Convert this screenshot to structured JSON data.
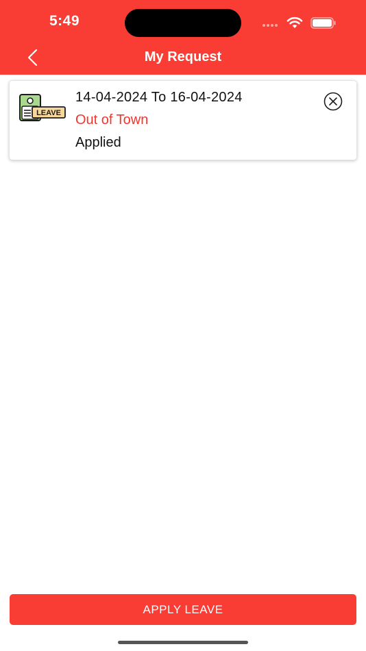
{
  "status_bar": {
    "time": "5:49"
  },
  "nav": {
    "title": "My Request",
    "back_icon": "chevron-left-icon"
  },
  "requests": [
    {
      "icon": "leave-badge-icon",
      "icon_label": "LEAVE",
      "date_range": "14-04-2024 To 16-04-2024",
      "reason": "Out of Town",
      "status": "Applied",
      "cancel_icon": "close-circle-icon"
    }
  ],
  "footer": {
    "apply_label": "APPLY LEAVE"
  },
  "colors": {
    "primary": "#f93d35",
    "reason_text": "#f2352c",
    "text": "#111111",
    "background": "#ffffff"
  }
}
